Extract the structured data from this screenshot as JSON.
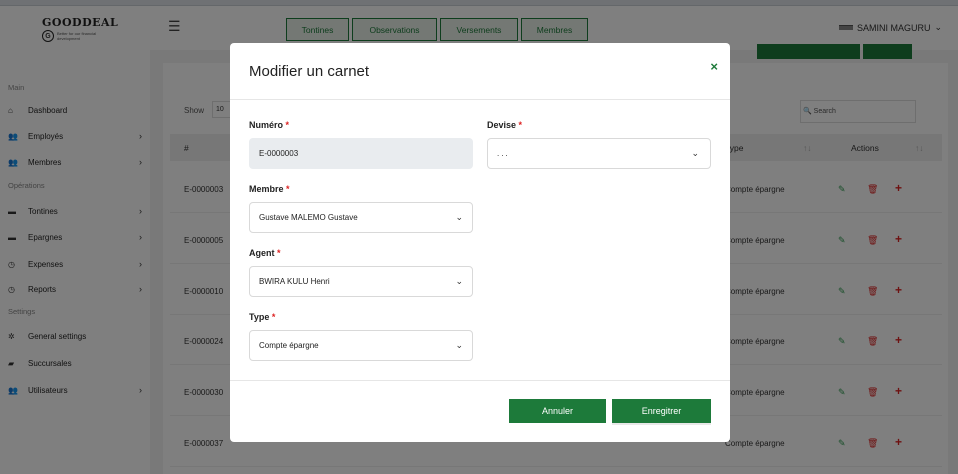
{
  "brand": {
    "name": "GOODDEAL",
    "tagline": "Better for our financial development",
    "initial": "G"
  },
  "topbar": {
    "tabs": [
      "Tontines",
      "Observations",
      "Versements",
      "Membres"
    ],
    "user": "SAMINI MAGURU"
  },
  "sidebar": {
    "sections": [
      "Main",
      "Opérations",
      "Settings"
    ],
    "items": [
      {
        "label": "Dashboard",
        "icon": "home-icon",
        "glyph": "⌂",
        "chevron": false
      },
      {
        "label": "Employés",
        "icon": "users-icon",
        "glyph": "👥",
        "chevron": true
      },
      {
        "label": "Membres",
        "icon": "users-icon",
        "glyph": "👥",
        "chevron": true
      },
      {
        "label": "Tontines",
        "icon": "card-icon",
        "glyph": "▬",
        "chevron": true
      },
      {
        "label": "Epargnes",
        "icon": "card-icon",
        "glyph": "▬",
        "chevron": true
      },
      {
        "label": "Expenses",
        "icon": "clock-icon",
        "glyph": "◷",
        "chevron": true
      },
      {
        "label": "Reports",
        "icon": "clock-icon",
        "glyph": "◷",
        "chevron": true
      },
      {
        "label": "General settings",
        "icon": "gear-icon",
        "glyph": "✲",
        "chevron": false
      },
      {
        "label": "Succursales",
        "icon": "car-icon",
        "glyph": "▰",
        "chevron": false
      },
      {
        "label": "Utilisateurs",
        "icon": "users-icon",
        "glyph": "👥",
        "chevron": true
      }
    ]
  },
  "table": {
    "show_label": "Show",
    "show_value": "10",
    "search_placeholder": "Search",
    "headers": {
      "num": "#",
      "type": "Type",
      "actions": "Actions"
    },
    "rows": [
      {
        "num": "E-0000003",
        "type": "Compte épargne"
      },
      {
        "num": "E-0000005",
        "type": "Compte épargne"
      },
      {
        "num": "E-0000010",
        "type": "Compte épargne"
      },
      {
        "num": "E-0000024",
        "type": "Compte épargne"
      },
      {
        "num": "E-0000030",
        "type": "Compte épargne"
      },
      {
        "num": "E-0000037",
        "type": "Compte épargne"
      }
    ]
  },
  "modal": {
    "title": "Modifier un carnet",
    "close_glyph": "×",
    "fields": {
      "numero": {
        "label": "Numéro",
        "value": "E-0000003"
      },
      "devise": {
        "label": "Devise",
        "value": "..."
      },
      "membre": {
        "label": "Membre",
        "value": "Gustave MALEMO Gustave"
      },
      "agent": {
        "label": "Agent",
        "value": "BWIRA KULU Henri"
      },
      "type": {
        "label": "Type",
        "value": "Compte épargne"
      }
    },
    "required_mark": "*",
    "buttons": {
      "cancel": "Annuler",
      "save": "Enregitrer"
    }
  },
  "colors": {
    "primary": "#1d7a3a",
    "danger": "#dd2222",
    "overlay": "rgba(0,0,0,0.5)"
  }
}
